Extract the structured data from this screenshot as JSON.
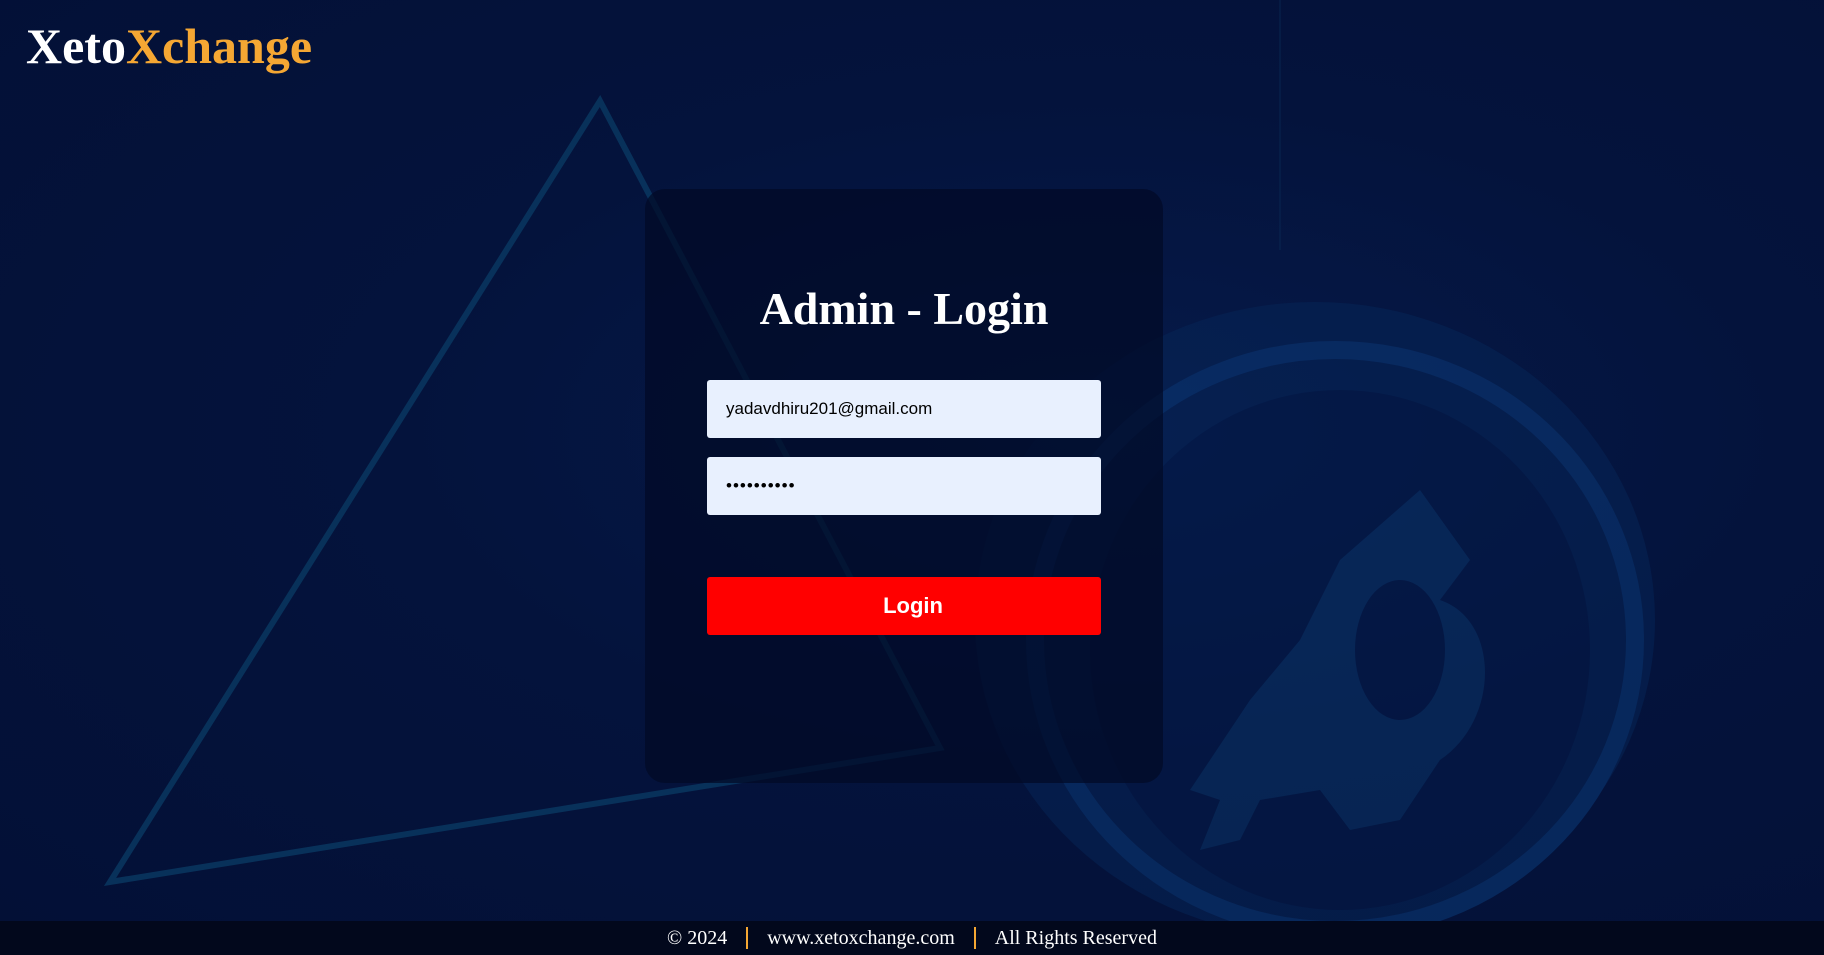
{
  "brand": {
    "name_part1": "Xeto",
    "name_part2": "Xchange",
    "accent_color": "#f5a733"
  },
  "login": {
    "title": "Admin - Login",
    "email_value": "yadavdhiru201@gmail.com",
    "password_value": "••••••••••",
    "button_label": "Login",
    "button_color": "#ff0000",
    "field_background": "#e8f0fe"
  },
  "footer": {
    "copyright": "© 2024",
    "website": "www.xetoxchange.com",
    "rights": "All Rights Reserved"
  },
  "background": {
    "base_color": "#04123a",
    "decorations": [
      "triangle-outline",
      "bitcoin-coin"
    ]
  }
}
